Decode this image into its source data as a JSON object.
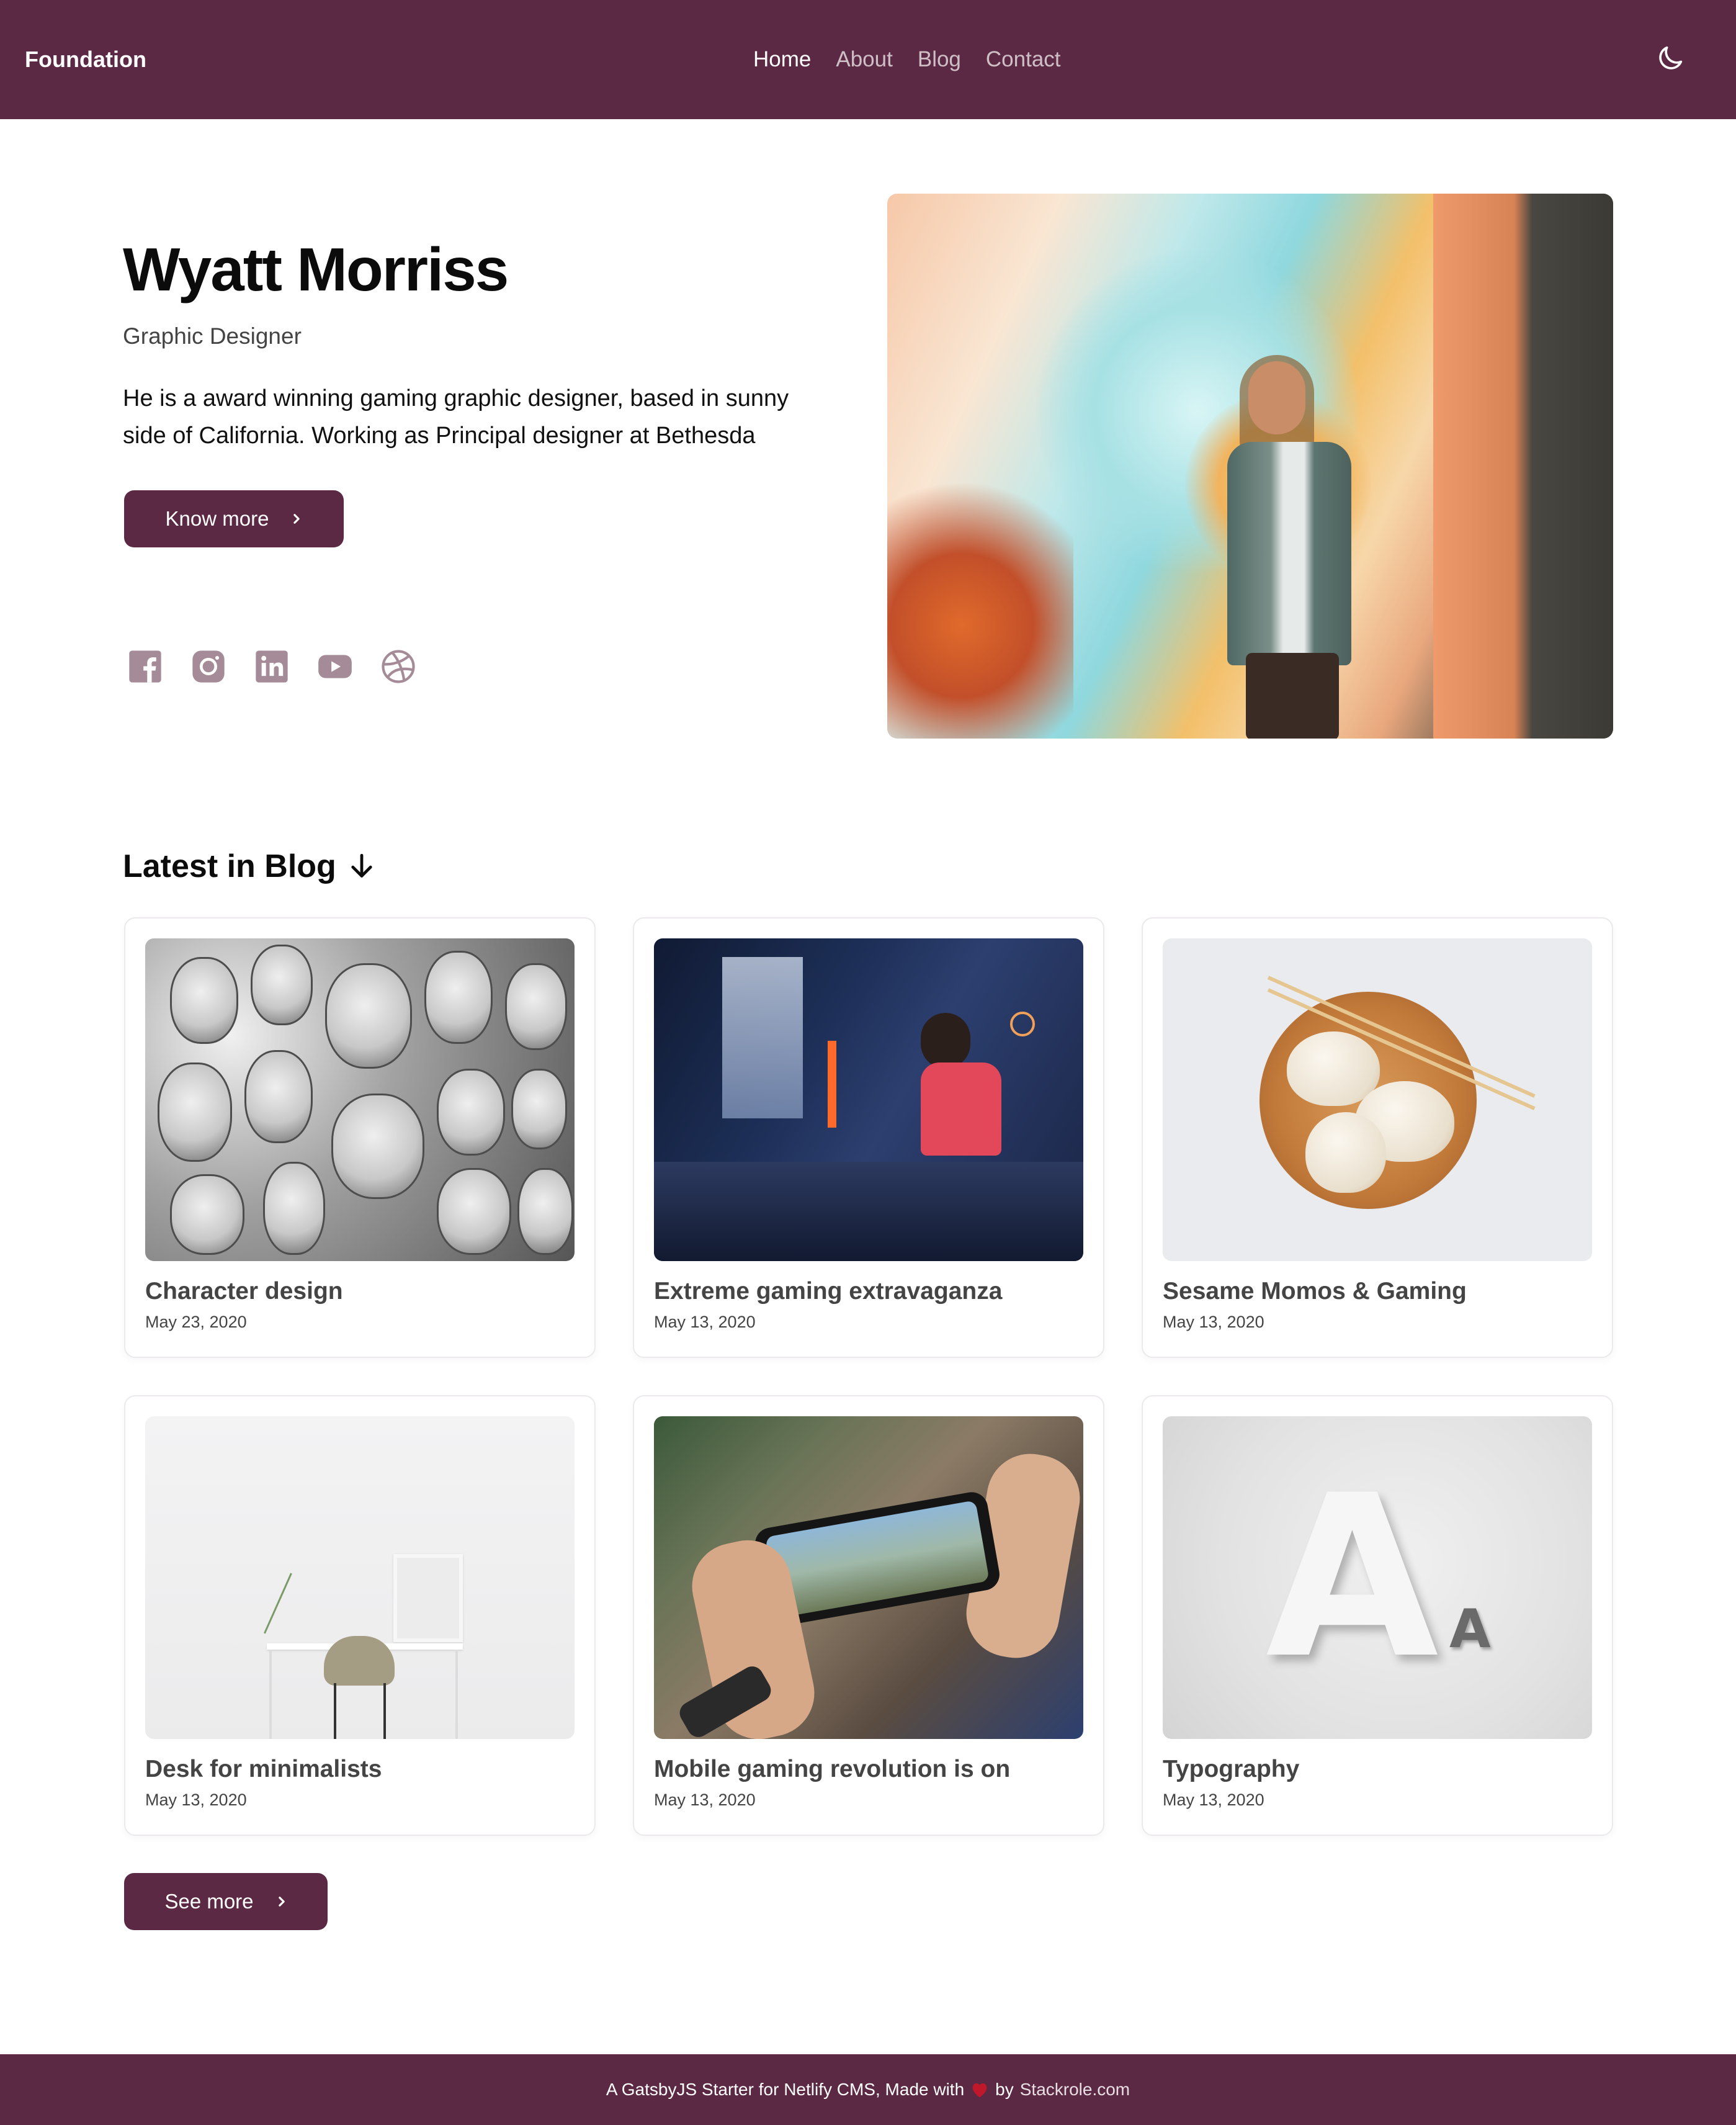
{
  "header": {
    "brand": "Foundation",
    "nav": [
      "Home",
      "About",
      "Blog",
      "Contact"
    ],
    "active_nav": "Home",
    "theme_toggle_icon": "moon-icon"
  },
  "hero": {
    "name": "Wyatt Morriss",
    "role": "Graphic Designer",
    "description": "He is a award winning gaming graphic designer, based in sunny side of California. Working as Principal designer at Bethesda",
    "cta_label": "Know more",
    "cta_icon": "chevron-right-icon",
    "socials": [
      "facebook-icon",
      "instagram-icon",
      "linkedin-icon",
      "youtube-icon",
      "dribbble-icon"
    ],
    "image": "portrait-photo"
  },
  "blog": {
    "heading": "Latest in Blog",
    "heading_icon": "arrow-down-icon",
    "posts": [
      {
        "title": "Character design",
        "date": "May 23, 2020"
      },
      {
        "title": "Extreme gaming extravaganza",
        "date": "May 13, 2020"
      },
      {
        "title": "Sesame Momos & Gaming",
        "date": "May 13, 2020"
      },
      {
        "title": "Desk for minimalists",
        "date": "May 13, 2020"
      },
      {
        "title": "Mobile gaming revolution is on",
        "date": "May 13, 2020"
      },
      {
        "title": "Typography",
        "date": "May 13, 2020"
      }
    ],
    "see_more_label": "See more"
  },
  "footer": {
    "text_before": "A GatsbyJS Starter for Netlify CMS, Made with",
    "text_after": "by",
    "link": "Stackrole.com",
    "heart_color": "#c0182b"
  },
  "colors": {
    "brand": "#5c2944",
    "icon_muted": "#a48b97"
  }
}
